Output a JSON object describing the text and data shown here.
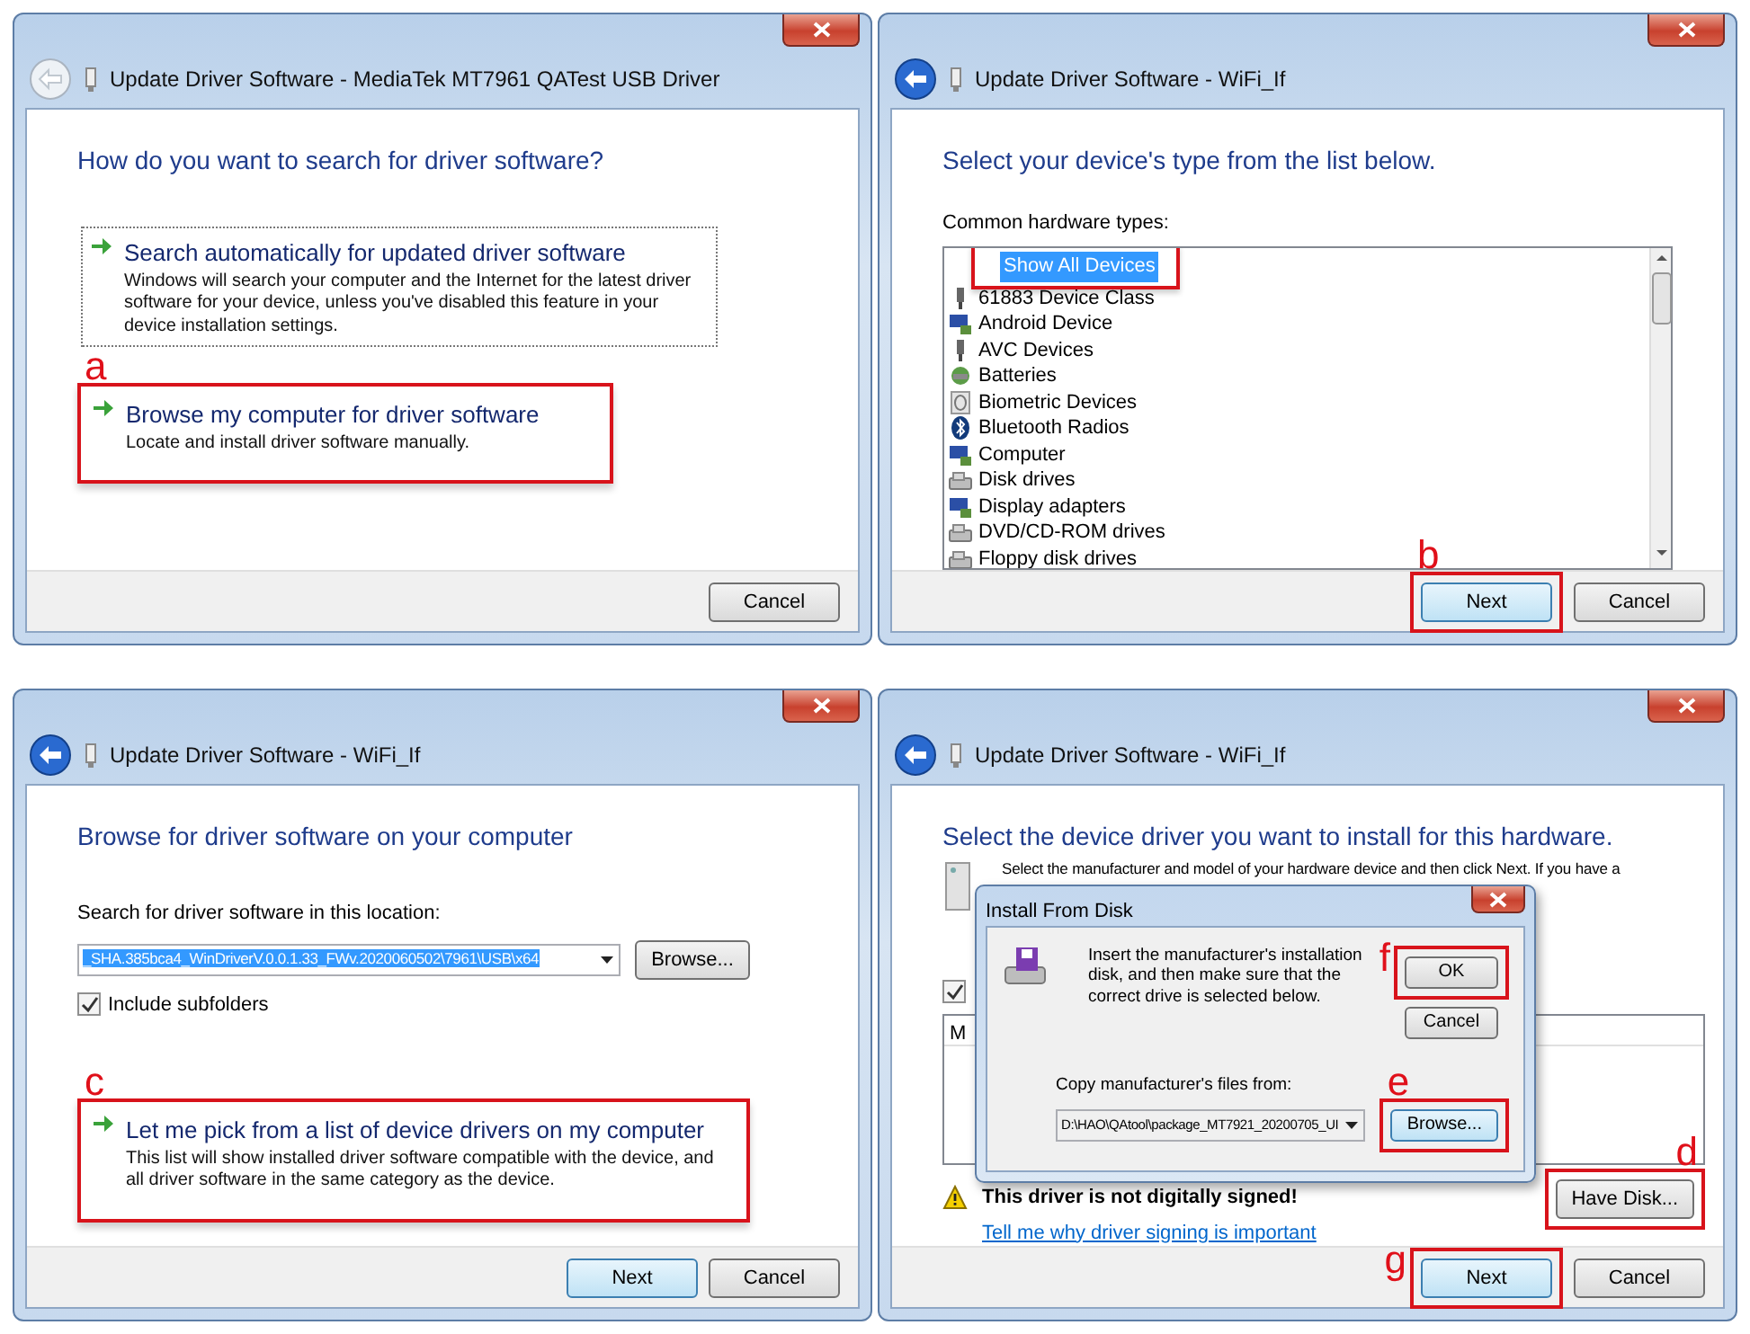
{
  "windows": [
    {
      "kind": "search-options",
      "title": "Update Driver Software - MediaTek MT7961 QATest USB Driver",
      "back_enabled": false,
      "heading": "How do you want to search for driver software?",
      "options": [
        {
          "title": "Search automatically for updated driver software",
          "description": "Windows will search your computer and the Internet for the latest driver software for your device, unless you've disabled this feature in your device installation settings.",
          "focused": true,
          "highlighted": false
        },
        {
          "title": "Browse my computer for driver software",
          "description": "Locate and install driver software manually.",
          "focused": false,
          "highlighted": true,
          "callout": "a"
        }
      ],
      "buttons": [
        {
          "label": "Cancel",
          "default": false,
          "highlighted": false
        }
      ]
    },
    {
      "kind": "device-types",
      "title": "Update Driver Software - WiFi_If",
      "back_enabled": true,
      "heading": "Select your device's type from the list below.",
      "list_label": "Common hardware types:",
      "items": [
        {
          "label": "Show All Devices",
          "selected": true,
          "highlighted": true
        },
        {
          "label": "61883 Device Class",
          "selected": false,
          "highlighted": false
        },
        {
          "label": "Android Device",
          "selected": false,
          "highlighted": false
        },
        {
          "label": "AVC Devices",
          "selected": false,
          "highlighted": false
        },
        {
          "label": "Batteries",
          "selected": false,
          "highlighted": false
        },
        {
          "label": "Biometric Devices",
          "selected": false,
          "highlighted": false
        },
        {
          "label": "Bluetooth Radios",
          "selected": false,
          "highlighted": false
        },
        {
          "label": "Computer",
          "selected": false,
          "highlighted": false
        },
        {
          "label": "Disk drives",
          "selected": false,
          "highlighted": false
        },
        {
          "label": "Display adapters",
          "selected": false,
          "highlighted": false
        },
        {
          "label": "DVD/CD-ROM drives",
          "selected": false,
          "highlighted": false
        },
        {
          "label": "Floppy disk drives",
          "selected": false,
          "highlighted": false
        }
      ],
      "buttons": [
        {
          "label": "Next",
          "default": true,
          "highlighted": true,
          "callout": "b"
        },
        {
          "label": "Cancel",
          "default": false,
          "highlighted": false
        }
      ]
    },
    {
      "kind": "browse-location",
      "title": "Update Driver Software - WiFi_If",
      "back_enabled": true,
      "heading": "Browse for driver software on your computer",
      "location_label": "Search for driver software in this location:",
      "location_value": "_SHA.385bca4_WinDriverV.0.0.1.33_FWv.2020060502\\7961\\USB\\x64",
      "value_selected": true,
      "browse_label": "Browse...",
      "subfolders_label": "Include subfolders",
      "subfolders_checked": true,
      "options": [
        {
          "title": "Let me pick from a list of device drivers on my computer",
          "description": "This list will show installed driver software compatible with the device, and all driver software in the same category as the device.",
          "focused": false,
          "highlighted": true,
          "callout": "c"
        }
      ],
      "buttons": [
        {
          "label": "Next",
          "default": true,
          "highlighted": false
        },
        {
          "label": "Cancel",
          "default": false,
          "highlighted": false
        }
      ]
    },
    {
      "kind": "select-driver",
      "title": "Update Driver Software - WiFi_If",
      "back_enabled": true,
      "heading": "Select the device driver you want to install for this hardware.",
      "instruction": "Select the manufacturer and model of your hardware device and then click Next. If you have a",
      "compatible_checked": true,
      "list_header": "M",
      "warning": "This driver is not digitally signed!",
      "link": "Tell me why driver signing is important",
      "have_disk": {
        "label": "Have Disk...",
        "default": false,
        "highlighted": true,
        "callout": "d"
      },
      "buttons": [
        {
          "label": "Next",
          "default": true,
          "highlighted": true,
          "callout": "g"
        },
        {
          "label": "Cancel",
          "default": false,
          "highlighted": false
        }
      ],
      "dialog": {
        "title": "Install From Disk",
        "message": "Insert the manufacturer's installation disk, and then make sure that the correct drive is selected below.",
        "copy_label": "Copy manufacturer's files from:",
        "path": "D:\\HAO\\QAtool\\package_MT7921_20200705_UI",
        "buttons": [
          {
            "label": "OK",
            "default": false,
            "highlighted": true,
            "callout": "f"
          },
          {
            "label": "Cancel",
            "default": false,
            "highlighted": false
          }
        ],
        "browse": {
          "label": "Browse...",
          "default": true,
          "highlighted": true,
          "callout": "e"
        }
      }
    }
  ]
}
